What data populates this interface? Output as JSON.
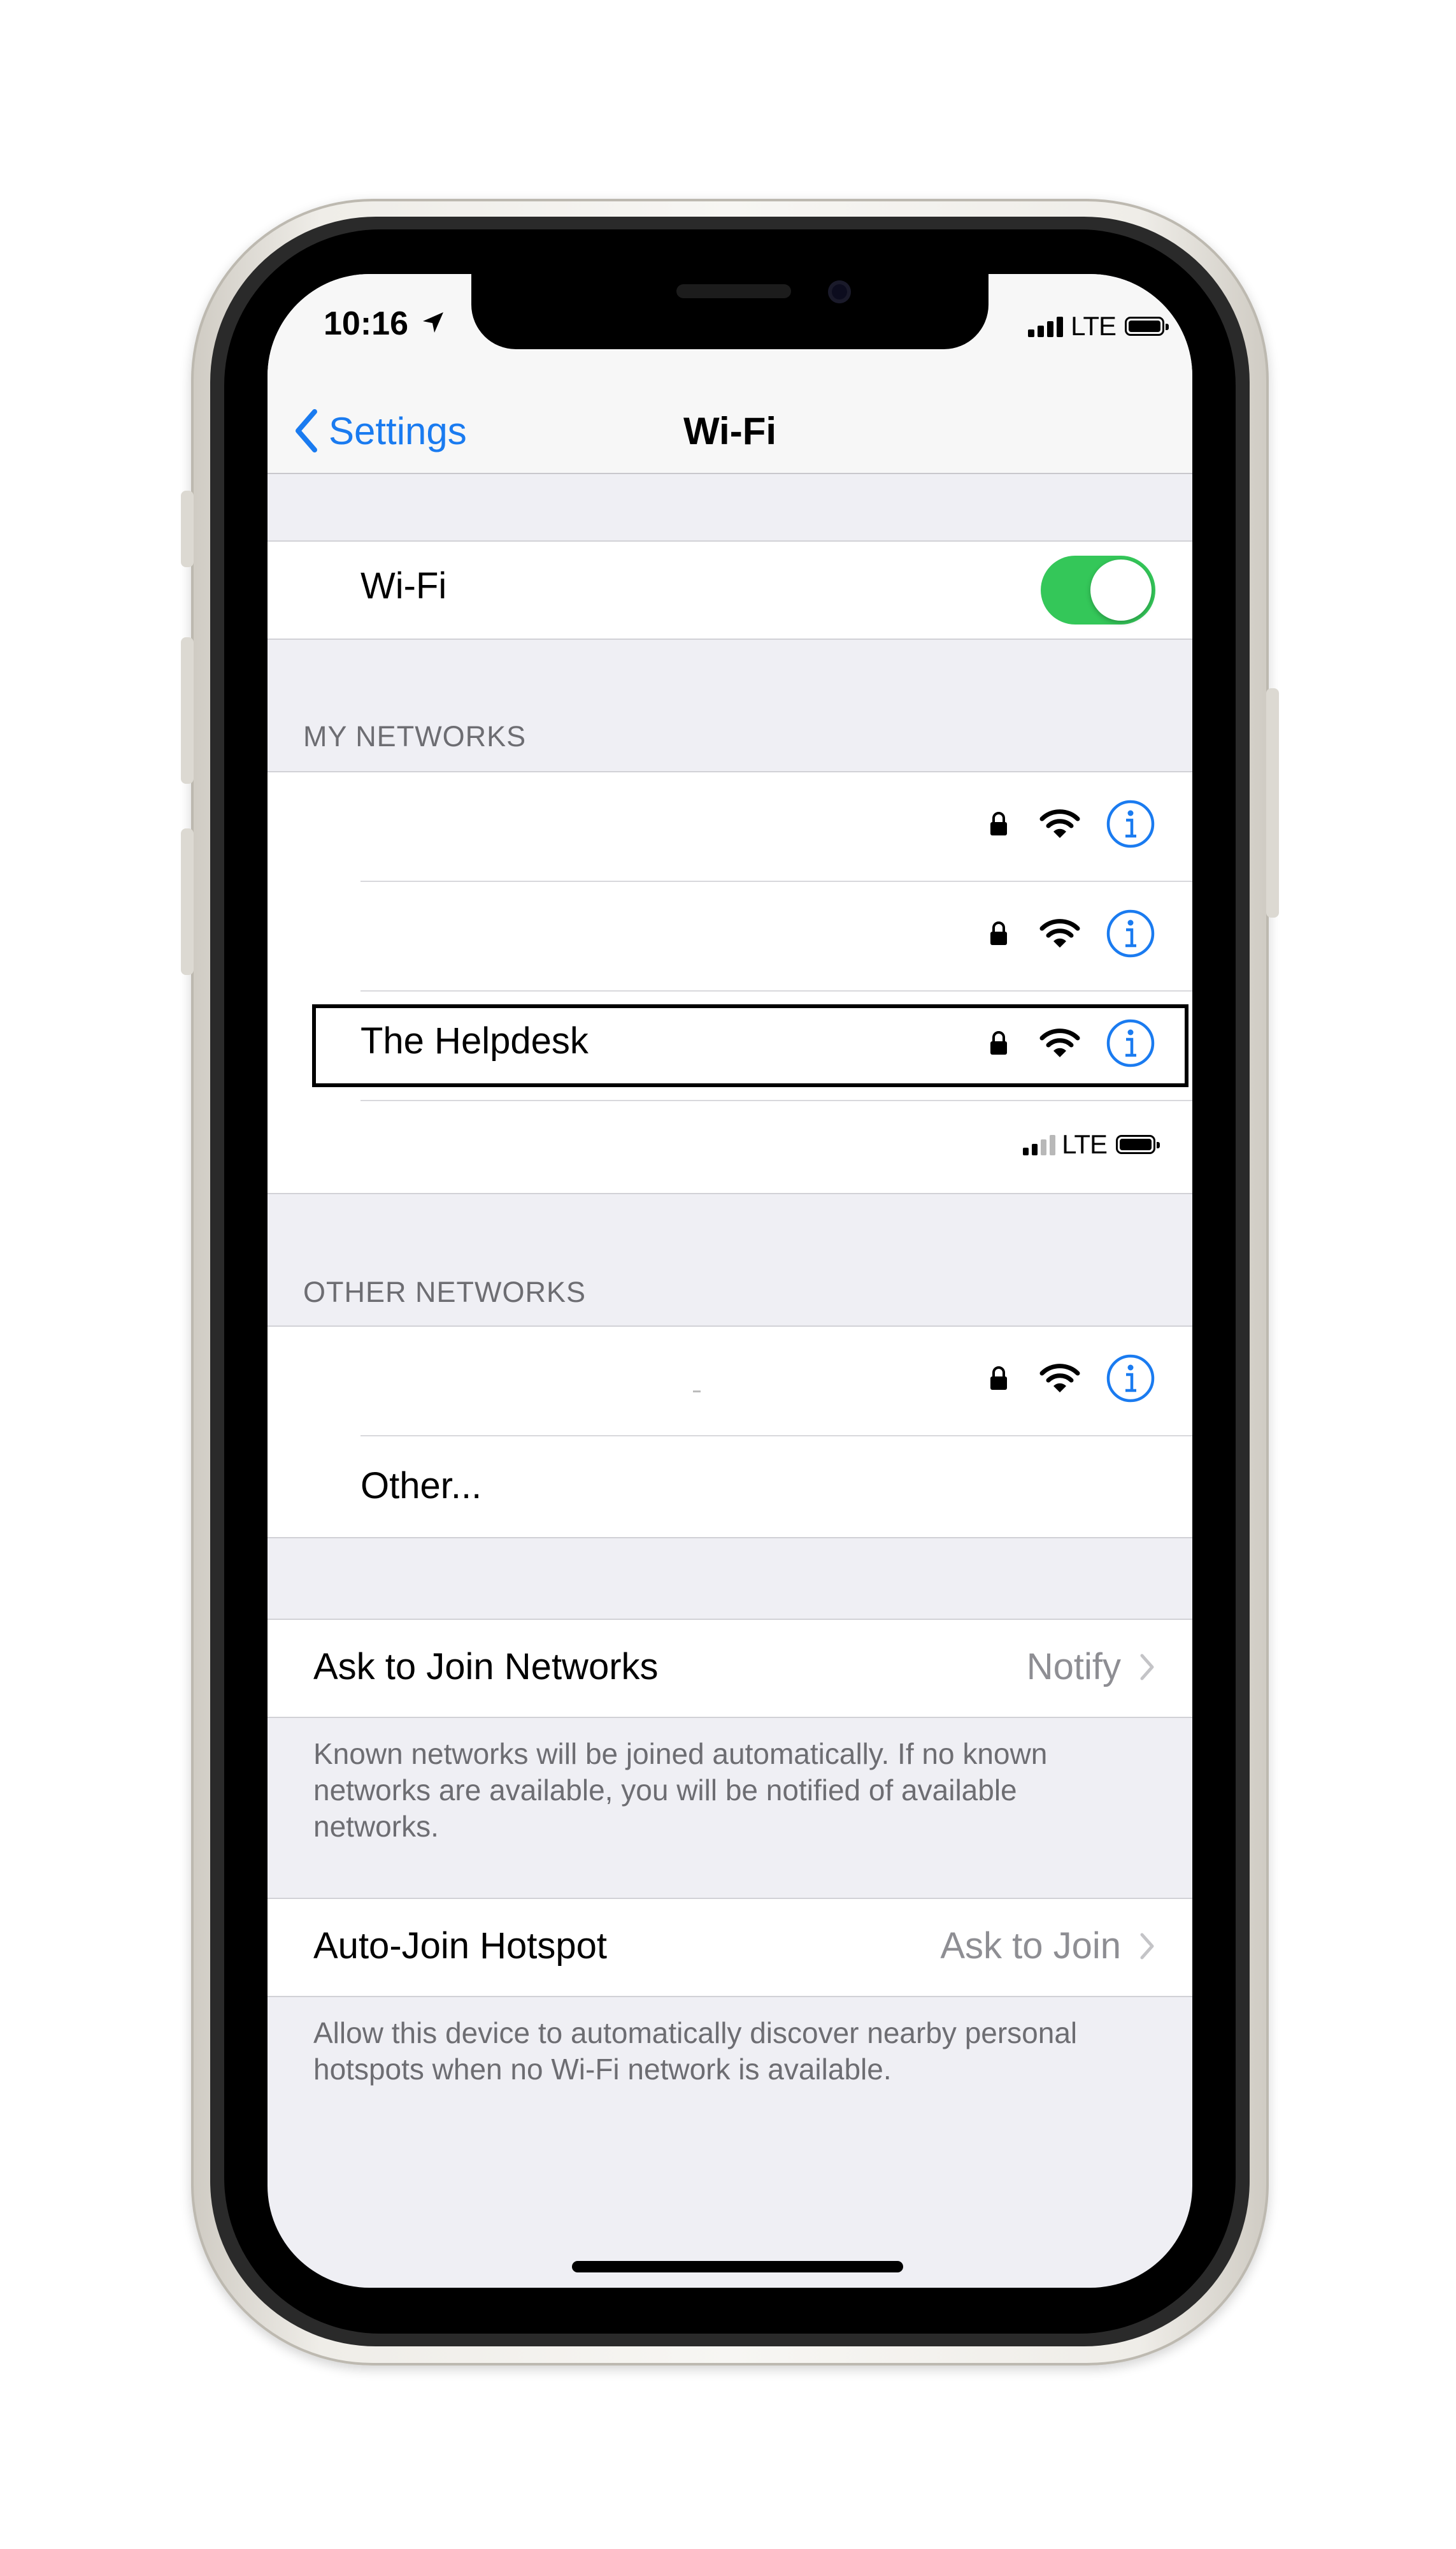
{
  "status_bar": {
    "time": "10:16",
    "network_type": "LTE",
    "location_icon": "location-arrow-icon",
    "signal_icon": "cellular-signal-icon",
    "battery_icon": "battery-icon"
  },
  "nav": {
    "back_label": "Settings",
    "back_icon": "chevron-left-icon",
    "title": "Wi-Fi"
  },
  "wifi_toggle": {
    "label": "Wi-Fi",
    "state": "on"
  },
  "my_networks": {
    "header": "MY NETWORKS",
    "items": [
      {
        "name": "",
        "secured": true,
        "icons": [
          "lock-icon",
          "wifi-icon",
          "info-icon"
        ]
      },
      {
        "name": "",
        "secured": true,
        "icons": [
          "lock-icon",
          "wifi-icon",
          "info-icon"
        ]
      },
      {
        "name": "The Helpdesk",
        "secured": true,
        "highlighted": true,
        "icons": [
          "lock-icon",
          "wifi-icon",
          "info-icon"
        ]
      },
      {
        "name": "",
        "type": "hotspot",
        "network_type": "LTE"
      }
    ]
  },
  "other_networks": {
    "header": "OTHER NETWORKS",
    "items": [
      {
        "name": "",
        "secured": true,
        "icons": [
          "lock-icon",
          "wifi-icon",
          "info-icon"
        ]
      },
      {
        "name": "Other..."
      }
    ]
  },
  "ask_to_join": {
    "label": "Ask to Join Networks",
    "value": "Notify",
    "footer": "Known networks will be joined automatically. If no known networks are available, you will be notified of available networks."
  },
  "auto_join_hotspot": {
    "label": "Auto-Join Hotspot",
    "value": "Ask to Join",
    "footer": "Allow this device to automatically discover nearby personal hotspots when no Wi-Fi network is available."
  },
  "colors": {
    "accent": "#1a7bf0",
    "toggle_on": "#34c759",
    "group_background": "#efeff4",
    "secondary_text": "#6d6d72"
  }
}
